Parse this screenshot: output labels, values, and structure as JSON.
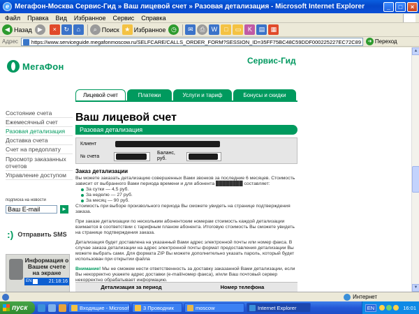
{
  "window": {
    "title": "Мегафон-Москва Сервис-Гид » Ваш лицевой счет » Разовая детализация - Microsoft Internet Explorer",
    "min_label": "_",
    "max_label": "□",
    "close_label": "×"
  },
  "menu": [
    "Файл",
    "Правка",
    "Вид",
    "Избранное",
    "Сервис",
    "Справка"
  ],
  "toolbar": {
    "back_label": "Назад",
    "search_label": "Поиск",
    "favorites_label": "Избранное"
  },
  "address": {
    "label": "Адрес",
    "url": "https://www.serviceguide.megafonmoscow.ru/SELFCARE/CALLS_ORDER_FORM?SESSION_ID=35FF75BC48C59DDF000225227EC72C89",
    "go_label": "Переход"
  },
  "site": {
    "logo": "МегаФон",
    "service_guide": "Сервис-Гид"
  },
  "tabs": [
    {
      "label": "Лицевой счет",
      "active": true
    },
    {
      "label": "Платежи",
      "active": false
    },
    {
      "label": "Услуги и тариф",
      "active": false
    },
    {
      "label": "Бонусы и скидки",
      "active": false
    }
  ],
  "sidebar": {
    "items": [
      {
        "label": "Состояние счета",
        "active": false
      },
      {
        "label": "Ежемесячный счет",
        "active": false
      },
      {
        "label": "Разовая детализация",
        "active": true
      },
      {
        "label": "Доставка счета",
        "active": false
      },
      {
        "label": "Счет на предоплату",
        "active": false
      },
      {
        "label": "Просмотр заказанных отчетов",
        "active": false
      },
      {
        "label": "Управление доступом",
        "active": false
      }
    ],
    "newsletter_label": "подписка на новости",
    "email_value": "Ваш E-mail",
    "email_go": "►",
    "sms_icon": ":)",
    "sms_label": "Отправить SMS",
    "widget_text": "Информация о Вашем счете на экране",
    "widget_lang": "EN",
    "widget_time": "21:18:16"
  },
  "main": {
    "page_title": "Ваш лицевой счет",
    "section_title": "Разовая детализация",
    "client_label": "Клиент",
    "client_value": "",
    "account_label": "№ счета",
    "account_value": "",
    "balance_label": "Баланс, руб.",
    "balance_value": "",
    "details_title": "Заказ детализации",
    "p1": "Вы можете заказать детализацию совершенных Вами звонков за последние 6 месяцев. Стоимость зависит от выбранного Вами периода времени и для абонента ████████ составляет:",
    "prices": [
      "За сутки — 4,5 руб.",
      "За неделю — 27 руб.",
      "За месяц — 90 руб."
    ],
    "p2": "Стоимость при выборе произвольного периода Вы сможете увидеть на странице подтверждения заказа.",
    "p3": "При заказе детализации по нескольким абонентским номерам стоимость каждой детализации взимается в соответствии с тарифным планом абонента. Итоговую стоимость Вы сможете увидеть на странице подтверждения заказа.",
    "p4": "Детализация будет доставлена на указанный Вами адрес электронной почты или номер факса. В случае заказа детализации на адрес электронной почты формат предоставления детализации Вы можете выбрать сами. Для формата ZIP Вы можете дополнительно указать пароль, который будет использован при открытии файла",
    "warn_prefix": "Внимание!",
    "warn_text": "Мы не сможем нести ответственность за доставку заказанной Вами детализации, если Вы некорректно укажете адрес доставки (e-mail/номер факса), и/или Ваш почтовый сервер некорректно обрабатывает информацию.",
    "table_headers": [
      "Детализация за период",
      "Номер телефона"
    ]
  },
  "status": {
    "zone": "Интернет"
  },
  "taskbar": {
    "start_label": "пуск",
    "tasks": [
      {
        "label": "Входящие - Microsof...",
        "active": false,
        "color": "#f4c243"
      },
      {
        "label": "3 Проводник",
        "active": false,
        "color": "#f4c243"
      },
      {
        "label": "moscow",
        "active": false,
        "color": "#e8b84a"
      },
      {
        "label": "Internet Explorer",
        "active": true,
        "color": "#3a8fd9"
      }
    ],
    "lang": "EN",
    "clock": "16:01"
  },
  "colors": {
    "brand": "#00985f",
    "xp_blue": "#0447c9"
  }
}
